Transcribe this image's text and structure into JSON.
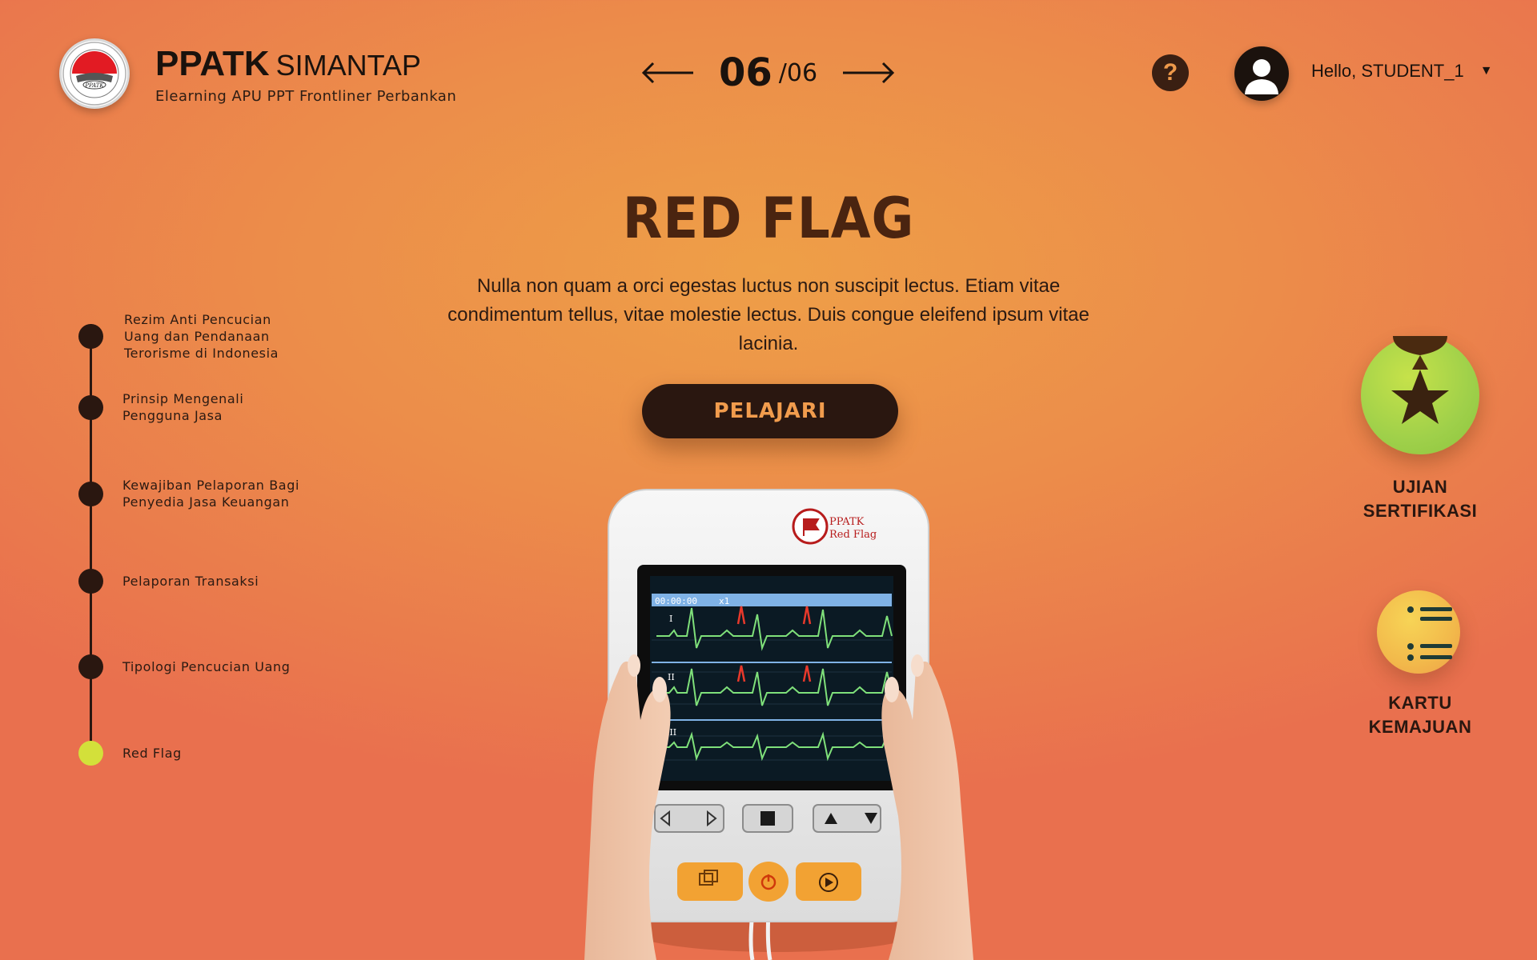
{
  "header": {
    "brand_bold": "PPATK",
    "brand_light": "SIMANTAP",
    "subtitle": "Elearning APU PPT Frontliner Perbankan",
    "logo_text": "PUSAT PELAPORAN DAN ANALISIS TRANSAKSI KEUANGAN",
    "logo_center": "PPATK"
  },
  "pager": {
    "current": "06",
    "total": "/06"
  },
  "help": {
    "label": "?"
  },
  "user": {
    "greeting": "Hello, STUDENT_1",
    "caret": "▼"
  },
  "hero": {
    "title": "RED FLAG",
    "description": "Nulla non quam a orci egestas luctus non suscipit lectus. Etiam vitae condimentum tellus, vitae molestie lectus. Duis congue eleifend ipsum vitae lacinia.",
    "cta": "PELAJARI"
  },
  "timeline": [
    {
      "label": "Rezim Anti Pencucian\nUang dan Pendanaan\nTerorisme di Indonesia",
      "active": false
    },
    {
      "label": "Prinsip Mengenali\nPengguna Jasa",
      "active": false
    },
    {
      "label": "Kewajiban Pelaporan Bagi\nPenyedia Jasa Keuangan",
      "active": false
    },
    {
      "label": "Pelaporan Transaksi",
      "active": false
    },
    {
      "label": "Tipologi Pencucian Uang",
      "active": false
    },
    {
      "label": "Red Flag",
      "active": true
    }
  ],
  "widgets": {
    "exam": "UJIAN\nSERTIFIKASI",
    "progress": "KARTU\nKEMAJUAN"
  },
  "device": {
    "brand_line1": "PPATK",
    "brand_line2": "Red Flag",
    "screen_time": "00:00:00",
    "screen_speed": "x1",
    "leads": [
      "I",
      "II",
      "III"
    ]
  },
  "colors": {
    "accent": "#ee9f47",
    "dark": "#2a1710",
    "active_dot": "#d3e03a",
    "medal": "#9fd04a"
  }
}
